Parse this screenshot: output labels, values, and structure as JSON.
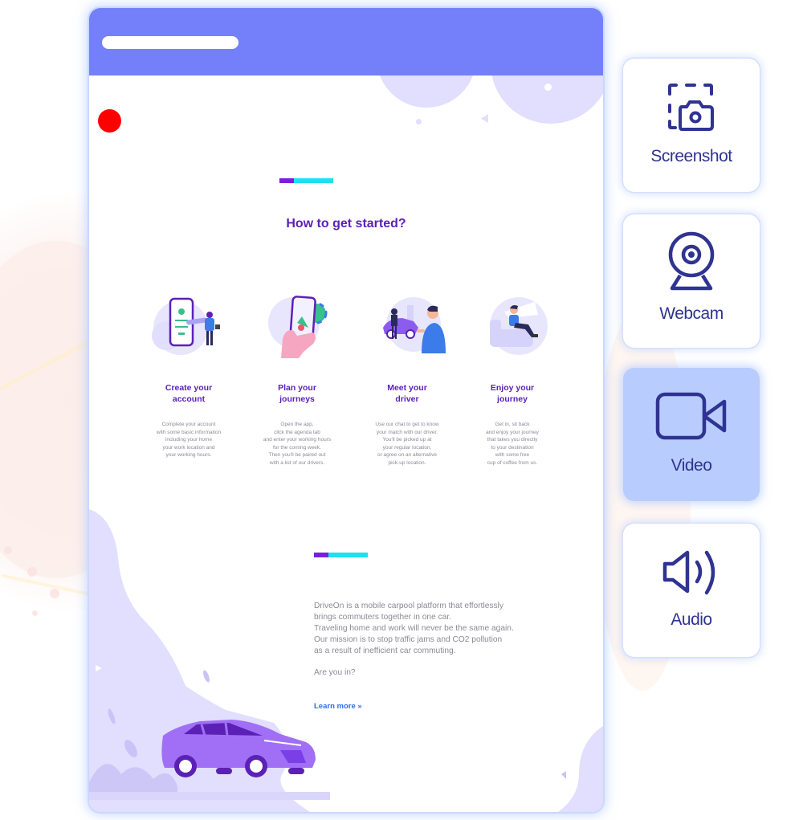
{
  "colors": {
    "header": "#7480f9",
    "accent_purple": "#7a1fe0",
    "accent_cyan": "#1fe0f2",
    "title_purple": "#5b21b6",
    "link_blue": "#2f6fe8",
    "tool_icon": "#2f3391",
    "tool_active_bg": "#b8cdfd",
    "record_indicator": "#ff0000"
  },
  "browser": {
    "url_bar_text": ""
  },
  "page": {
    "section_title": "How to get started?",
    "steps": [
      {
        "title": "Create your\naccount",
        "description": "Complete your account\nwith some basic information\nincluding your home\nyour work location and\nyour working hours.",
        "illustration": "phone-signup-illustration"
      },
      {
        "title": "Plan your\njourneys",
        "description": "Open the app,\nclick the agenda tab\nand enter your working hours\nfor the coming week.\nThen you'll be paired out\nwith a list of our drivers.",
        "illustration": "hand-phone-map-illustration"
      },
      {
        "title": "Meet your\ndriver",
        "description": "Use our chat to get to know\nyour match with our driver.\nYou'll be picked up at\nyour regular location,\nor agree on an alternative\npick-up location.",
        "illustration": "driver-meeting-illustration"
      },
      {
        "title": "Enjoy your\njourney",
        "description": "Get in, sit back\nand enjoy your journey\nthat takes you directly\nto your destination\nwith some free\ncup of coffee from us.",
        "illustration": "relaxing-passenger-illustration"
      }
    ],
    "about_text": "DriveOn is a mobile carpool platform that effortlessly\nbrings commuters together in one car.\nTraveling home and work will never be the same again.\nOur mission is to stop traffic jams and CO2 pollution\nas a result of inefficient car commuting.",
    "question": "Are you in?",
    "learn_more": "Learn more »"
  },
  "capture_tools": [
    {
      "label": "Screenshot",
      "icon": "screenshot-camera-icon",
      "active": false
    },
    {
      "label": "Webcam",
      "icon": "webcam-icon",
      "active": false
    },
    {
      "label": "Video",
      "icon": "video-camera-icon",
      "active": true
    },
    {
      "label": "Audio",
      "icon": "speaker-icon",
      "active": false
    }
  ]
}
